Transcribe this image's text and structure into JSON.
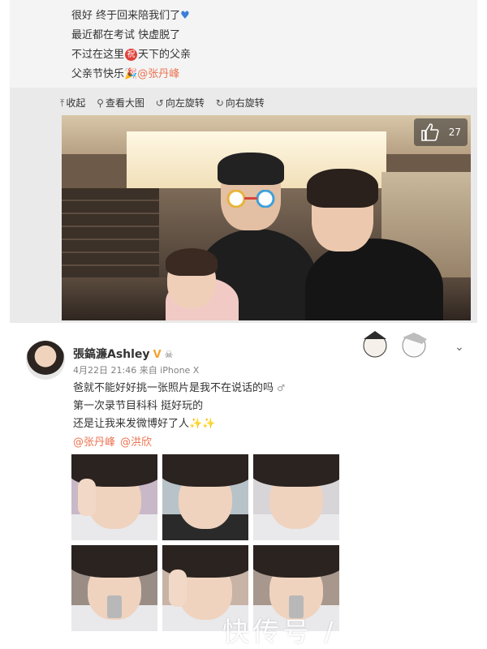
{
  "post1": {
    "lines": [
      "很好 终于回来陪我们了",
      "最近都在考试 快虚脱了",
      "不过在这里",
      "天下的父亲",
      "父亲节快乐"
    ],
    "zhu_char": "祝",
    "mention": "@张丹峰",
    "toolbar": [
      {
        "label": "收起",
        "icon": "up-arrow-icon"
      },
      {
        "label": "查看大图",
        "icon": "zoom-icon"
      },
      {
        "label": "向左旋转",
        "icon": "rotate-left-icon"
      },
      {
        "label": "向右旋转",
        "icon": "rotate-right-icon"
      }
    ],
    "like_count": "27"
  },
  "post2": {
    "username": "張鎬濂Ashley",
    "verified": "V",
    "meta": "4月22日 21:46 来自 iPhone X",
    "lines": [
      "爸就不能好好挑一张照片是我不在说话的吗",
      "第一次录节目科科   挺好玩的",
      "还是让我来发微博好了人"
    ],
    "mentions": [
      "@张丹峰",
      "@洪欣"
    ]
  },
  "watermark": "快传号 /",
  "colors": {
    "mention": "#eb7350",
    "verified": "#f3a530",
    "panel": "#f4f4f4"
  }
}
